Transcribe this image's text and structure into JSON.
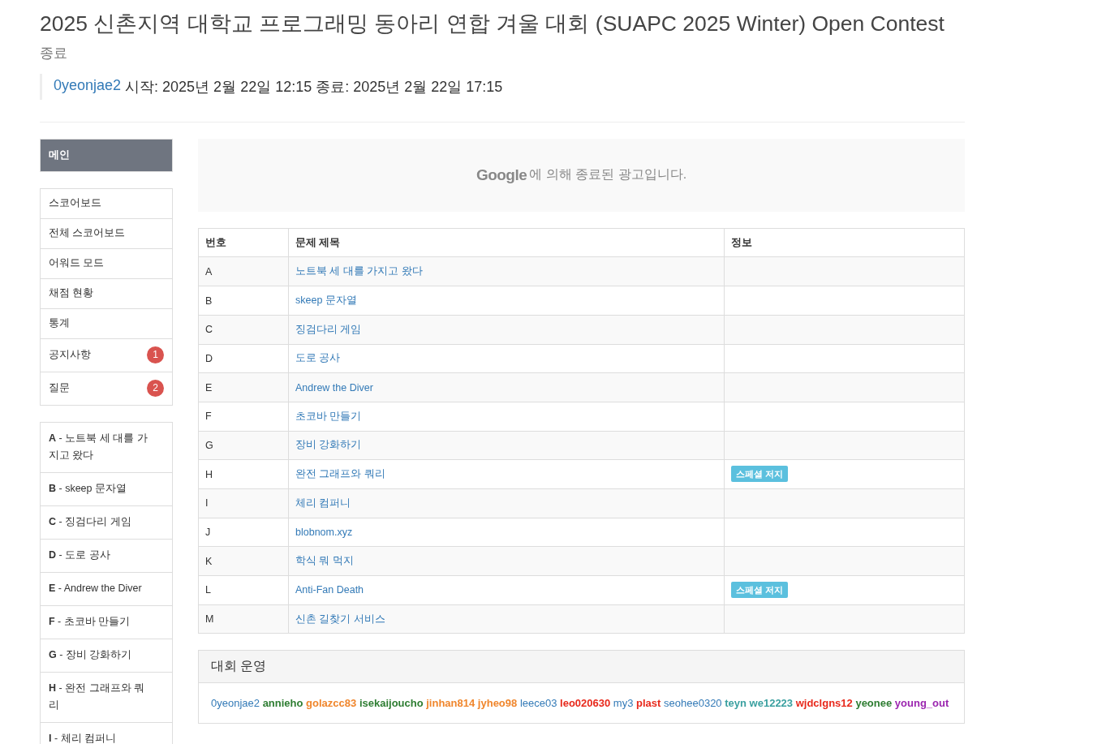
{
  "header": {
    "title": "2025 신촌지역 대학교 프로그래밍 동아리 연합 겨울 대회 (SUAPC 2025 Winter) Open Contest",
    "status": "종료",
    "author": "0yeonjae2",
    "schedule": "시작: 2025년 2월 22일 12:15 종료: 2025년 2월 22일 17:15"
  },
  "sidebar": {
    "main": {
      "label": "메인",
      "selected": true
    },
    "menu": [
      {
        "label": "스코어보드",
        "selected": false
      },
      {
        "label": "전체 스코어보드",
        "selected": false
      },
      {
        "label": "어워드 모드",
        "selected": false
      },
      {
        "label": "채점 현황",
        "selected": false
      },
      {
        "label": "통계",
        "selected": false
      },
      {
        "label": "공지사항",
        "badge": "1",
        "selected": false
      },
      {
        "label": "질문",
        "badge": "2",
        "selected": false
      }
    ],
    "problems": [
      {
        "label": "**A** - 노트북 세 대를 가지고 왔다",
        "selected": false
      },
      {
        "label": "**B** - skeep 문자열",
        "selected": false
      },
      {
        "label": "**C** - 징검다리 게임",
        "selected": false
      },
      {
        "label": "**D** - 도로 공사",
        "selected": false
      },
      {
        "label": "**E** - Andrew the Diver",
        "selected": false
      },
      {
        "label": "**F** - 초코바 만들기",
        "selected": false
      },
      {
        "label": "**G** - 장비 강화하기",
        "selected": false
      },
      {
        "label": "**H** - 완전 그래프와 쿼리",
        "selected": false
      },
      {
        "label": "**I** - 체리 컴퍼니",
        "selected": false
      }
    ]
  },
  "ad": {
    "logo": "Google",
    "message": "에 의해 종료된 광고입니다."
  },
  "table": {
    "columns": [
      "번호",
      "문제 제목",
      "정보"
    ],
    "rows": [
      {
        "number": "A",
        "title": "노트북 세 대를 가지고 왔다"
      },
      {
        "number": "B",
        "title": "skeep 문자열"
      },
      {
        "number": "C",
        "title": "징검다리 게임"
      },
      {
        "number": "D",
        "title": "도로 공사"
      },
      {
        "number": "E",
        "title": "Andrew the Diver"
      },
      {
        "number": "F",
        "title": "초코바 만들기"
      },
      {
        "number": "G",
        "title": "장비 강화하기"
      },
      {
        "number": "H",
        "title": "완전 그래프와 쿼리",
        "info": "스페셜 저지"
      },
      {
        "number": "I",
        "title": "체리 컴퍼니"
      },
      {
        "number": "J",
        "title": "blobnom.xyz"
      },
      {
        "number": "K",
        "title": "학식 뭐 먹지"
      },
      {
        "number": "L",
        "title": "Anti-Fan Death",
        "info": "스페셜 저지"
      },
      {
        "number": "M",
        "title": "신촌 길찾기 서비스"
      }
    ]
  },
  "staff": {
    "title": "대회 운영",
    "members": [
      {
        "name": "0yeonjae2",
        "color": "#337ab7",
        "bold": false
      },
      {
        "name": "annieho",
        "color": "#2e7d32",
        "bold": true
      },
      {
        "name": "golazcc83",
        "color": "#f0862c",
        "bold": true
      },
      {
        "name": "isekaijoucho",
        "color": "#2e7d32",
        "bold": true
      },
      {
        "name": "jinhan814",
        "color": "#f0862c",
        "bold": true
      },
      {
        "name": "jyheo98",
        "color": "#f0862c",
        "bold": true
      },
      {
        "name": "leece03",
        "color": "#337ab7",
        "bold": false
      },
      {
        "name": "leo020630",
        "color": "#e8291c",
        "bold": true
      },
      {
        "name": "my3",
        "color": "#337ab7",
        "bold": false
      },
      {
        "name": "plast",
        "color": "#e8291c",
        "bold": true
      },
      {
        "name": "seohee0320",
        "color": "#337ab7",
        "bold": false
      },
      {
        "name": "teyn",
        "color": "#3aa0a0",
        "bold": true
      },
      {
        "name": "we12223",
        "color": "#3aa0a0",
        "bold": true
      },
      {
        "name": "wjdclgns12",
        "color": "#e8291c",
        "bold": true
      },
      {
        "name": "yeonee",
        "color": "#2e7d32",
        "bold": true
      },
      {
        "name": "young_out",
        "color": "#9c27b0",
        "bold": true
      }
    ]
  }
}
